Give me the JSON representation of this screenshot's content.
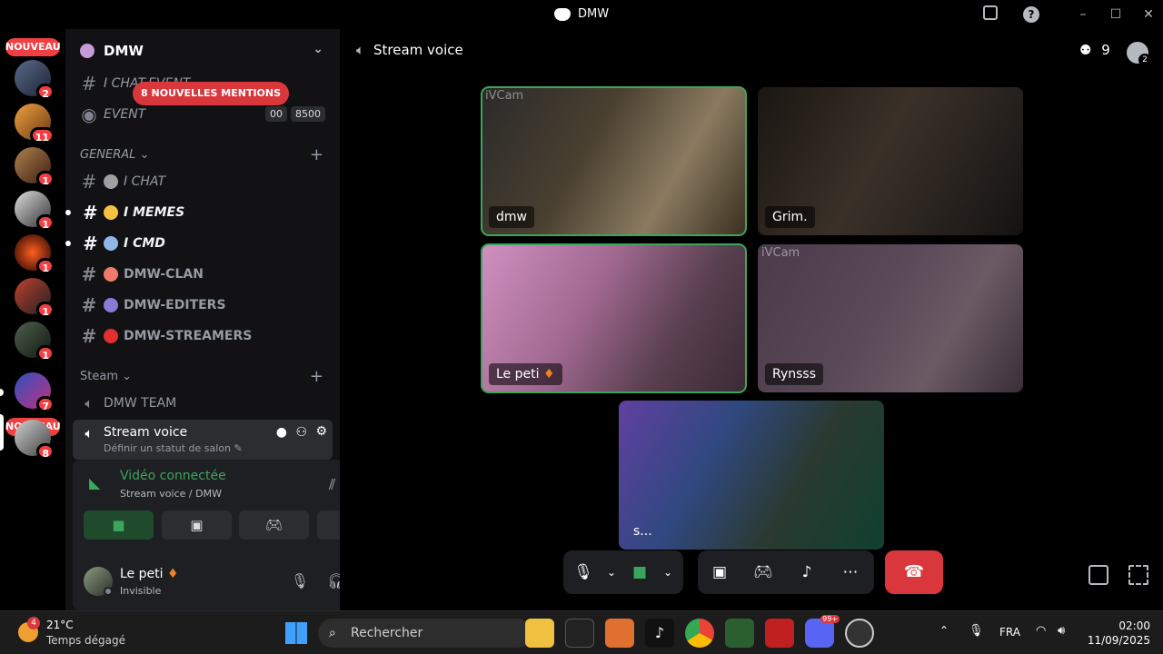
{
  "window": {
    "title": "DMW"
  },
  "servers": {
    "nouveau_top": "NOUVEAU",
    "nouveau_bottom": "NOUVEAU",
    "badges": [
      "2",
      "11",
      "1",
      "1",
      "1",
      "1",
      "1",
      "7",
      "8"
    ]
  },
  "guild": {
    "name": "DMW"
  },
  "channels": {
    "mentions_banner": "8 NOUVELLES MENTIONS",
    "chat_event": "I CHAT-EVENT",
    "event": "EVENT",
    "event_badge_a": "00",
    "event_badge_b": "8500",
    "cat_general": "GENERAL",
    "chat": "I CHAT",
    "memes": "I MEMES",
    "cmd": "I CMD",
    "clan": "DMW-CLAN",
    "editers": "DMW-EDITERS",
    "streamers": "DMW-STREAMERS",
    "cat_steam": "Steam",
    "team": "DMW TEAM",
    "stream_voice": "Stream voice",
    "stream_voice_status": "Définir un statut de salon"
  },
  "voice_panel": {
    "title": "Vidéo connectée",
    "subtitle": "Stream voice / DMW"
  },
  "user": {
    "name": "Le peti",
    "status": "Invisible"
  },
  "main": {
    "channel_title": "Stream voice",
    "member_count": "9",
    "thread_badge": "2",
    "tiles": [
      {
        "name": "dmw",
        "watermark": "iVCam"
      },
      {
        "name": "Grim.",
        "watermark": ""
      },
      {
        "name": "Le peti",
        "watermark": ""
      },
      {
        "name": "Rynsss",
        "watermark": "iVCam"
      },
      {
        "name": "s...",
        "watermark": ""
      }
    ]
  },
  "taskbar": {
    "weather_temp": "21°C",
    "weather_desc": "Temps dégagé",
    "weather_badge": "4",
    "search_placeholder": "Rechercher",
    "lang": "FRA",
    "time": "02:00",
    "date": "11/09/2025",
    "discord_badge": "99+"
  },
  "colors": {
    "green": "#3ba55c",
    "red": "#da373c",
    "bg_sidebar": "#121214",
    "bg_panel": "#1e1f22"
  }
}
